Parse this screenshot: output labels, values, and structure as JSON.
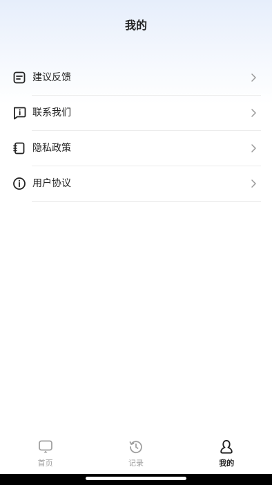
{
  "header": {
    "title": "我的"
  },
  "menu": {
    "items": [
      {
        "label": "建议反馈",
        "icon": "feedback-note-icon"
      },
      {
        "label": "联系我们",
        "icon": "contact-chat-info-icon"
      },
      {
        "label": "隐私政策",
        "icon": "privacy-notebook-icon"
      },
      {
        "label": "用户协议",
        "icon": "info-circle-icon"
      }
    ]
  },
  "tabbar": {
    "tabs": [
      {
        "label": "首页",
        "icon": "tv-screen-icon",
        "active": false
      },
      {
        "label": "记录",
        "icon": "history-clock-icon",
        "active": false
      },
      {
        "label": "我的",
        "icon": "person-icon",
        "active": true
      }
    ]
  },
  "colors": {
    "header_gradient_top": "#e6eefb",
    "text_primary": "#222222",
    "tab_inactive": "#a0a0a0",
    "divider": "#ebebeb"
  }
}
